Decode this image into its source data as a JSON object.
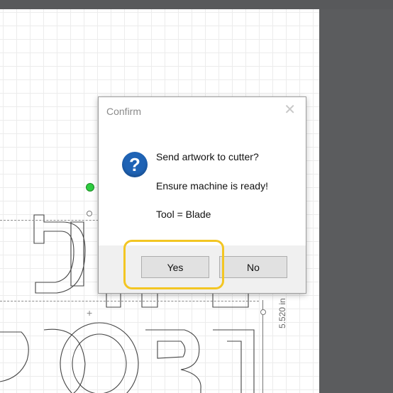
{
  "dialog": {
    "title": "Confirm",
    "close_glyph": "✕",
    "icon": "question-icon",
    "icon_glyph": "?",
    "messages": [
      "Send artwork to cutter?",
      "Ensure machine is ready!",
      "Tool = Blade"
    ],
    "yes_label": "Yes",
    "no_label": "No",
    "highlight_color": "#f3c623"
  },
  "canvas": {
    "dimension_label": "5.520 in",
    "crosshair_glyph": "+"
  }
}
